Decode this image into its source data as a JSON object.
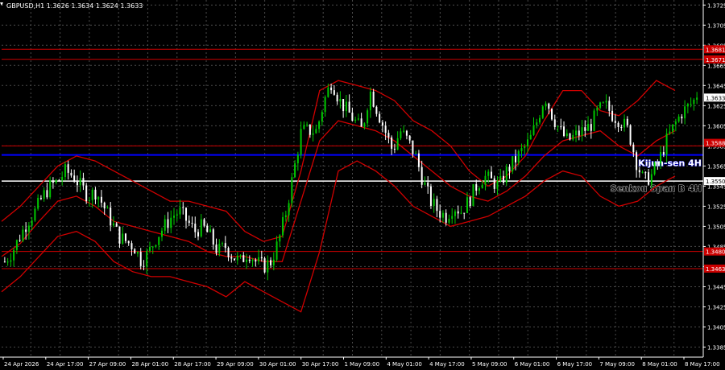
{
  "header": {
    "text": "GBPUSD,H1   1.3626 1.3634 1.3624 1.3633"
  },
  "colors": {
    "background": "#000000",
    "grid": "#4a4a4a",
    "bull_candle": "#00c800",
    "bear_candle": "#ffffff",
    "band": "#d00000",
    "level": "#cc0000",
    "kijun": "#0000ff",
    "senkou": "#ffffff",
    "axis_text": "#ffffff"
  },
  "chart_data": {
    "type": "candlestick",
    "symbol": "GBPUSD",
    "timeframe": "H1",
    "ohlc_current": {
      "open": 1.3626,
      "high": 1.3634,
      "low": 1.3624,
      "close": 1.3633
    },
    "ylim": [
      1.3375,
      1.373
    ],
    "y_ticks": [
      1.3385,
      1.3405,
      1.3425,
      1.3445,
      1.3465,
      1.3485,
      1.3505,
      1.3525,
      1.3545,
      1.3565,
      1.3585,
      1.3605,
      1.3625,
      1.3645,
      1.3665,
      1.3685,
      1.3705,
      1.3725
    ],
    "x_labels": [
      "24 Apr 2026",
      "24 Apr 17:00",
      "27 Apr 09:00",
      "28 Apr 01:00",
      "28 Apr 17:00",
      "29 Apr 09:00",
      "30 Apr 01:00",
      "30 Apr 17:00",
      "1 May 09:00",
      "4 May 01:00",
      "4 May 17:00",
      "5 May 09:00",
      "6 May 01:00",
      "6 May 17:00",
      "7 May 09:00",
      "8 May 01:00",
      "8 May 17:00"
    ],
    "price_path": [
      1.347,
      1.348,
      1.3495,
      1.351,
      1.352,
      1.3535,
      1.3545,
      1.355,
      1.356,
      1.3555,
      1.3545,
      1.3535,
      1.354,
      1.3525,
      1.351,
      1.3495,
      1.349,
      1.3485,
      1.347,
      1.348,
      1.3495,
      1.3505,
      1.3515,
      1.352,
      1.351,
      1.35,
      1.3505,
      1.3495,
      1.348,
      1.3485,
      1.3475,
      1.347,
      1.348,
      1.347,
      1.3465,
      1.347,
      1.349,
      1.352,
      1.356,
      1.36,
      1.36,
      1.36,
      1.363,
      1.365,
      1.363,
      1.362,
      1.361,
      1.36,
      1.364,
      1.362,
      1.36,
      1.358,
      1.36,
      1.359,
      1.3575,
      1.355,
      1.353,
      1.352,
      1.3515,
      1.3525,
      1.352,
      1.353,
      1.3545,
      1.3555,
      1.355,
      1.3545,
      1.356,
      1.357,
      1.358,
      1.359,
      1.361,
      1.3635,
      1.3615,
      1.36,
      1.359,
      1.3595,
      1.36,
      1.3605,
      1.362,
      1.3625,
      1.3615,
      1.361,
      1.36,
      1.357,
      1.355,
      1.3555,
      1.357,
      1.359,
      1.3605,
      1.3618,
      1.3625,
      1.3633
    ],
    "bands": {
      "upper": [
        1.351,
        1.3525,
        1.3545,
        1.3565,
        1.3575,
        1.357,
        1.356,
        1.355,
        1.354,
        1.353,
        1.353,
        1.3525,
        1.352,
        1.35,
        1.349,
        1.3495,
        1.356,
        1.364,
        1.365,
        1.3645,
        1.364,
        1.363,
        1.361,
        1.36,
        1.3585,
        1.356,
        1.3545,
        1.3555,
        1.3575,
        1.361,
        1.364,
        1.364,
        1.362,
        1.3615,
        1.363,
        1.365,
        1.364
      ],
      "middle": [
        1.3475,
        1.3488,
        1.351,
        1.353,
        1.3535,
        1.3525,
        1.351,
        1.3505,
        1.35,
        1.3495,
        1.349,
        1.348,
        1.3475,
        1.3475,
        1.347,
        1.347,
        1.353,
        1.359,
        1.361,
        1.3605,
        1.36,
        1.359,
        1.3575,
        1.356,
        1.3545,
        1.3535,
        1.353,
        1.354,
        1.3555,
        1.3575,
        1.359,
        1.3595,
        1.36,
        1.3585,
        1.3575,
        1.359,
        1.36
      ],
      "lower": [
        1.344,
        1.3455,
        1.3475,
        1.3495,
        1.35,
        1.349,
        1.347,
        1.346,
        1.3455,
        1.3455,
        1.345,
        1.3445,
        1.3435,
        1.345,
        1.344,
        1.343,
        1.342,
        1.348,
        1.356,
        1.357,
        1.356,
        1.3545,
        1.3525,
        1.3515,
        1.3505,
        1.351,
        1.3515,
        1.3525,
        1.3535,
        1.355,
        1.356,
        1.3555,
        1.3535,
        1.3525,
        1.353,
        1.3545,
        1.3555
      ]
    },
    "horizontal_levels": [
      {
        "price": 1.3681,
        "label": "1.3681",
        "style": "level"
      },
      {
        "price": 1.3671,
        "label": "1.3671",
        "style": "level"
      },
      {
        "price": 1.3585,
        "label": "1.3588",
        "style": "level"
      },
      {
        "price": 1.3576,
        "label": "Kijun-sen 4H",
        "style": "kijun"
      },
      {
        "price": 1.355,
        "label": "Senkou Span B 4H",
        "style": "senkou"
      },
      {
        "price": 1.348,
        "label": "1.3480",
        "style": "level"
      },
      {
        "price": 1.3463,
        "label": "1.3463",
        "style": "level"
      }
    ],
    "axis_badges": [
      {
        "price": 1.3681,
        "label": "1.3681",
        "color": "#cc0000"
      },
      {
        "price": 1.3671,
        "label": "1.3671",
        "color": "#cc0000"
      },
      {
        "price": 1.3633,
        "label": "1.3633",
        "color": "#ffffff"
      },
      {
        "price": 1.3588,
        "label": "1.3588",
        "color": "#cc0000"
      },
      {
        "price": 1.355,
        "label": "1.3550",
        "color": "#ffffff"
      },
      {
        "price": 1.348,
        "label": "1.3480",
        "color": "#cc0000"
      },
      {
        "price": 1.3463,
        "label": "1.3463",
        "color": "#cc0000"
      }
    ],
    "annotations": [
      "Kijun-sen 4H",
      "Senkou Span B 4H"
    ]
  }
}
